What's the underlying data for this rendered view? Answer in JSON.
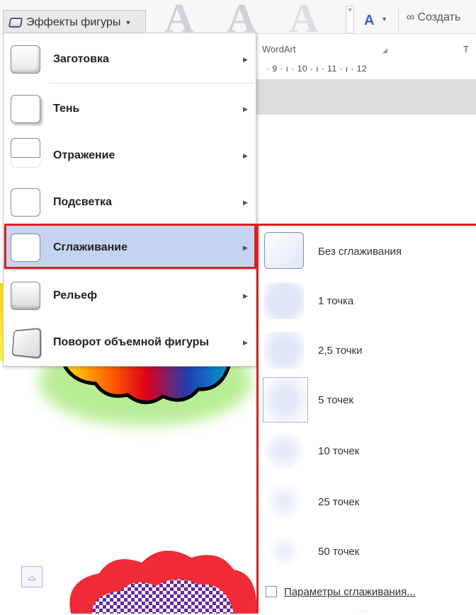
{
  "ribbon": {
    "effects_button": "Эффекты фигуры",
    "wordart_group": "WordArt",
    "create_link": "Создать",
    "t_label": "Т",
    "ruler_text": "· 9 · ı · 10 · ı · 11 · ı · 12"
  },
  "menu": {
    "items": [
      {
        "label": "Заготовка"
      },
      {
        "label": "Тень"
      },
      {
        "label": "Отражение"
      },
      {
        "label": "Подсветка"
      },
      {
        "label": "Сглаживание"
      },
      {
        "label": "Рельеф"
      },
      {
        "label": "Поворот объемной фигуры"
      }
    ],
    "selected": "Сглаживание"
  },
  "submenu": {
    "items": [
      {
        "label": "Без сглаживания"
      },
      {
        "label": "1 точка"
      },
      {
        "label": "2,5 точки"
      },
      {
        "label": "5 точек"
      },
      {
        "label": "10 точек"
      },
      {
        "label": "25 точек"
      },
      {
        "label": "50 точек"
      }
    ],
    "footer": "Параметры сглаживания..."
  },
  "colors": {
    "selected_bg": "#c4d4f0",
    "highlight": "#e01e1e",
    "accent": "#2b63c9"
  }
}
